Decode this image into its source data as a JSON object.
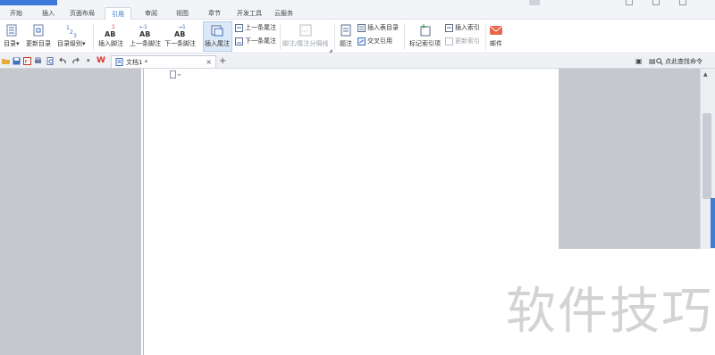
{
  "menu": {
    "tabs": [
      "开始",
      "插入",
      "页面布局",
      "引用",
      "审阅",
      "视图",
      "章节",
      "开发工具",
      "云服务"
    ],
    "active_tab": "引用"
  },
  "ribbon": {
    "toc_label": "目录",
    "update_toc_label": "更新目录",
    "toc_level_label": "目录级别",
    "insert_footnote_label": "插入脚注",
    "prev_footnote_label": "上一条脚注",
    "next_footnote_label": "下一条脚注",
    "insert_endnote_label": "插入尾注",
    "prev_endnote_label": "上一条尾注",
    "next_endnote_label": "下一条尾注",
    "separator_label": "脚注/尾注分隔线",
    "caption_label": "题注",
    "insert_table_toc_label": "插入表目录",
    "cross_ref_label": "交叉引用",
    "mark_index_label": "标记索引项",
    "insert_index_label": "插入索引",
    "update_index_label": "更新索引",
    "mail_label": "邮件",
    "footnote_icon_text": "AB",
    "footnote_icon_num": "1"
  },
  "doc_tabs": {
    "tab_label": "文档1 *",
    "close_glyph": "×",
    "add_glyph": "+"
  },
  "toolbar": {
    "find_command_label": "点此查找命令"
  },
  "watermark": "软件技巧",
  "colors": {
    "accent": "#2c6fcf",
    "brand_red": "#d9342b",
    "workspace_gray": "#c6c8ce"
  }
}
